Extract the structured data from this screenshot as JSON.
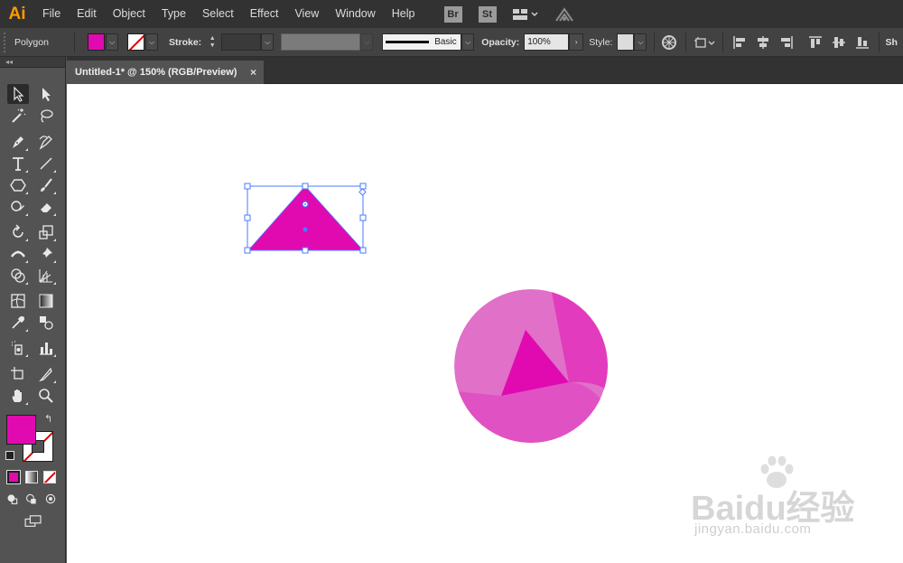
{
  "app": {
    "logo": "Ai",
    "menu": [
      "File",
      "Edit",
      "Object",
      "Type",
      "Select",
      "Effect",
      "View",
      "Window",
      "Help"
    ],
    "bridge_label": "Br",
    "stock_label": "St"
  },
  "control_bar": {
    "selection_label": "Polygon",
    "stroke_label": "Stroke:",
    "brush_label": "Basic",
    "opacity_label": "Opacity:",
    "opacity_value": "100%",
    "style_label": "Style:",
    "overflow_label": "Sh"
  },
  "tools_panel": {
    "collapse_glyph": "◂◂"
  },
  "document": {
    "tab_title": "Untitled-1* @ 150% (RGB/Preview)",
    "close_glyph": "×"
  },
  "colors": {
    "fill": "#e10ab1",
    "selection": "#4a7bff",
    "ball_light": "#e070c8",
    "ball_mid": "#e33bbd",
    "ball_dark": "#e10ab1"
  },
  "watermark": {
    "brand": "Baidu经验",
    "url": "jingyan.baidu.com"
  }
}
